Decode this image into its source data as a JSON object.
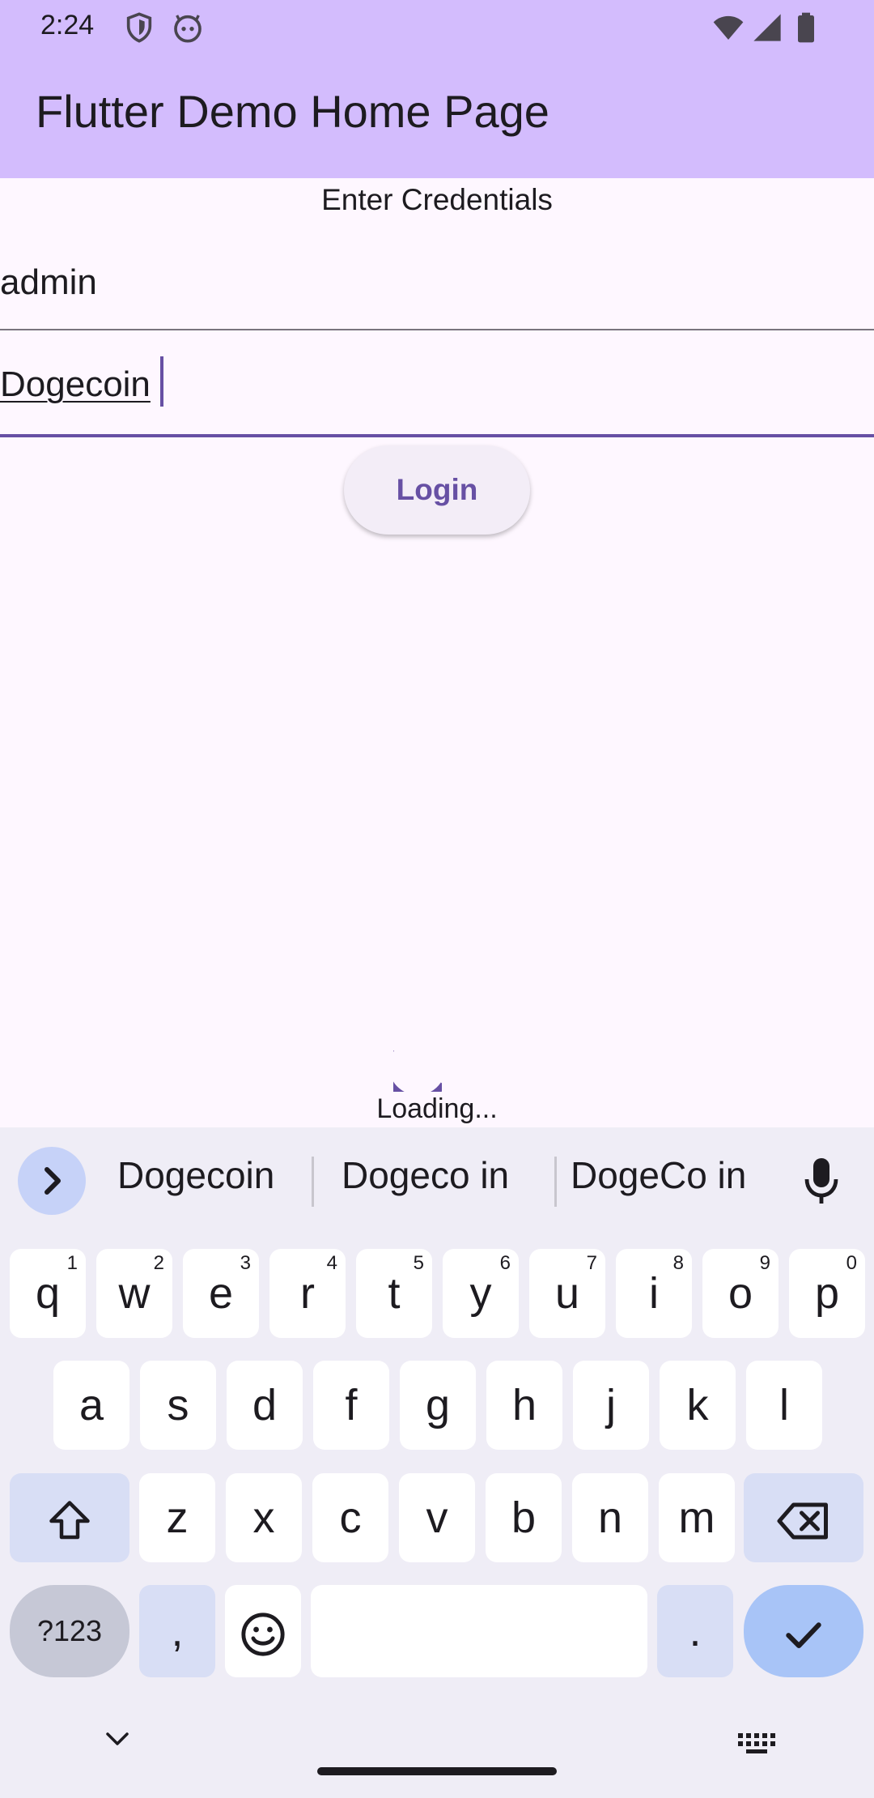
{
  "status_bar": {
    "time": "2:24",
    "icons": [
      "shield-icon",
      "android-face-icon",
      "wifi-icon",
      "signal-icon",
      "battery-icon"
    ]
  },
  "app_bar": {
    "title": "Flutter Demo Home Page"
  },
  "form": {
    "heading": "Enter Credentials",
    "username_value": "admin",
    "password_value": "Dogecoin",
    "login_label": "Login"
  },
  "loading": {
    "text": "Loading..."
  },
  "keyboard": {
    "suggestions": [
      "Dogecoin",
      "Dogeco in",
      "DogeCo in"
    ],
    "row1": [
      {
        "key": "q",
        "hint": "1"
      },
      {
        "key": "w",
        "hint": "2"
      },
      {
        "key": "e",
        "hint": "3"
      },
      {
        "key": "r",
        "hint": "4"
      },
      {
        "key": "t",
        "hint": "5"
      },
      {
        "key": "y",
        "hint": "6"
      },
      {
        "key": "u",
        "hint": "7"
      },
      {
        "key": "i",
        "hint": "8"
      },
      {
        "key": "o",
        "hint": "9"
      },
      {
        "key": "p",
        "hint": "0"
      }
    ],
    "row2": [
      "a",
      "s",
      "d",
      "f",
      "g",
      "h",
      "j",
      "k",
      "l"
    ],
    "row3": [
      "z",
      "x",
      "c",
      "v",
      "b",
      "n",
      "m"
    ],
    "symbols_label": "?123",
    "comma_label": ",",
    "period_label": "."
  },
  "colors": {
    "app_bar": "#d3bcfd",
    "primary": "#6750a4",
    "background": "#fef7ff",
    "keyboard_bg": "#efedf6",
    "enter_key": "#a8c4f7"
  }
}
